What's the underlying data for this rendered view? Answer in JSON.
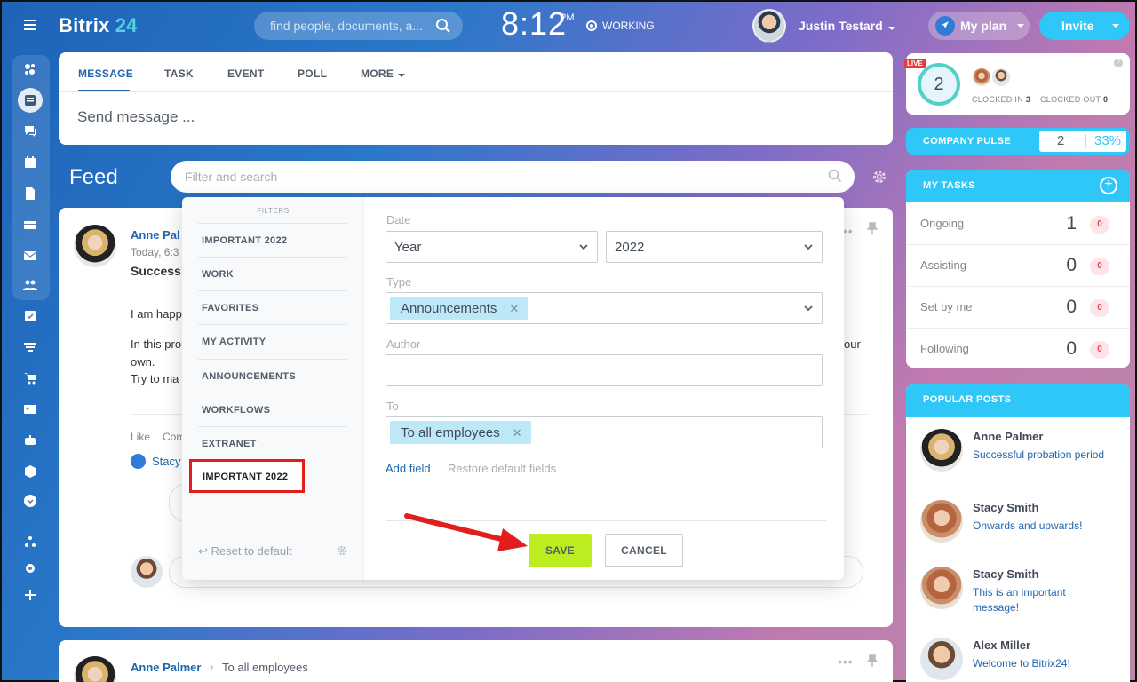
{
  "header": {
    "brand_main": "Bitrix",
    "brand_num": "24",
    "search_placeholder": "find people, documents, a...",
    "clock": "8:12",
    "ampm": "PM",
    "work_status": "WORKING",
    "user_name": "Justin Testard",
    "plan_label": "My plan",
    "invite_label": "Invite"
  },
  "composer": {
    "tabs": [
      "MESSAGE",
      "TASK",
      "EVENT",
      "POLL",
      "MORE"
    ],
    "placeholder": "Send message ..."
  },
  "feed": {
    "title": "Feed",
    "filter_placeholder": "Filter and search",
    "post1": {
      "author": "Anne Pal",
      "time": "Today, 6:3",
      "title": "Success",
      "line1": "I am happ",
      "line2": "In this pro",
      "line2_tail": "our",
      "line3": "own.",
      "line4": "Try to ma",
      "like": "Like",
      "comment": "Com",
      "liker": "Stacy"
    },
    "post2": {
      "author": "Anne Palmer",
      "recipient": "To all employees"
    }
  },
  "filter_popup": {
    "heading": "FILTERS",
    "presets": [
      "IMPORTANT 2022",
      "WORK",
      "FAVORITES",
      "MY ACTIVITY",
      "ANNOUNCEMENTS",
      "WORKFLOWS",
      "EXTRANET"
    ],
    "new_preset": "IMPORTANT 2022",
    "reset": "Reset to default",
    "date_label": "Date",
    "date_period": "Year",
    "date_value": "2022",
    "type_label": "Type",
    "type_tag": "Announcements",
    "author_label": "Author",
    "to_label": "To",
    "to_tag": "To all employees",
    "add_field": "Add field",
    "restore": "Restore default fields",
    "save": "SAVE",
    "cancel": "CANCEL"
  },
  "timeman": {
    "live": "LIVE",
    "count": "2",
    "clocked_in_label": "CLOCKED IN",
    "clocked_in": "3",
    "clocked_out_label": "CLOCKED OUT",
    "clocked_out": "0",
    "help": "?"
  },
  "pulse": {
    "label": "COMPANY PULSE",
    "value": "2",
    "percent": "33%"
  },
  "tasks": {
    "title": "MY TASKS",
    "rows": [
      {
        "name": "Ongoing",
        "count": "1",
        "badge": "0"
      },
      {
        "name": "Assisting",
        "count": "0",
        "badge": "0"
      },
      {
        "name": "Set by me",
        "count": "0",
        "badge": "0"
      },
      {
        "name": "Following",
        "count": "0",
        "badge": "0"
      }
    ]
  },
  "popular": {
    "title": "POPULAR POSTS",
    "posts": [
      {
        "name": "Anne Palmer",
        "text": "Successful probation period"
      },
      {
        "name": "Stacy Smith",
        "text": "Onwards and upwards!"
      },
      {
        "name": "Stacy Smith",
        "text": "This is an important message!"
      },
      {
        "name": "Alex Miller",
        "text": "Welcome to Bitrix24!"
      }
    ]
  },
  "colors": {
    "accent": "#2fc7f7",
    "link": "#2067b0",
    "save": "#bbed21",
    "highlight": "#e11d1d"
  }
}
